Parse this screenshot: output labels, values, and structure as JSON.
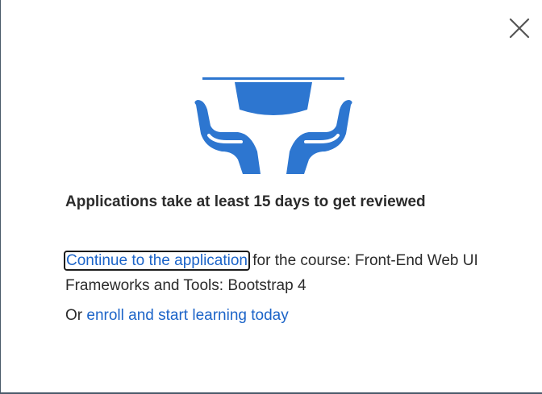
{
  "dialog": {
    "close_label": "Close",
    "headline": "Applications take at least 15 days to get reviewed",
    "continue_link": "Continue to the application",
    "course_text": "for the course: Front-End Web UI Frameworks and Tools: Bootstrap 4",
    "or_text": "Or",
    "enroll_link": "enroll and start learning today"
  },
  "icons": {
    "close": "close-icon",
    "illustration": "graduation-cap-hands-icon"
  },
  "colors": {
    "accent": "#2d76d0",
    "link": "#1c64c8",
    "text": "#2b2b2b"
  }
}
